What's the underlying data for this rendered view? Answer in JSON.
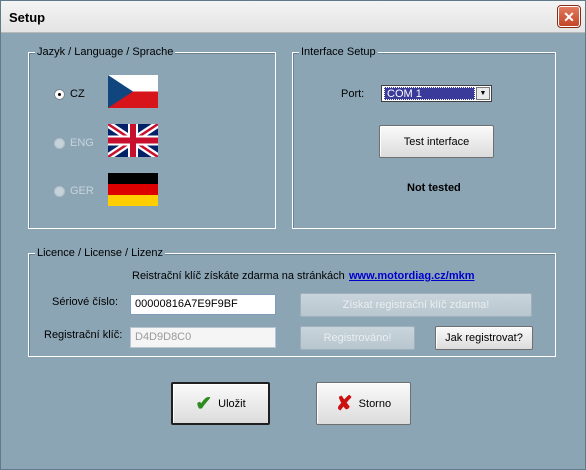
{
  "window": {
    "title": "Setup",
    "close_symbol": "✕"
  },
  "language_group": {
    "label": "Jazyk / Language / Sprache",
    "options": [
      {
        "label": "CZ",
        "selected": true,
        "enabled": true,
        "flag": "czech-flag"
      },
      {
        "label": "ENG",
        "selected": false,
        "enabled": false,
        "flag": "uk-flag"
      },
      {
        "label": "GER",
        "selected": false,
        "enabled": false,
        "flag": "german-flag"
      }
    ]
  },
  "interface_group": {
    "label": "Interface Setup",
    "port_label": "Port:",
    "port_value": "COM 1",
    "test_button": "Test interface",
    "status": "Not tested"
  },
  "licence_group": {
    "label": "Licence / License / Lizenz",
    "info_text": "Reistrační klíč získáte zdarma na stránkách",
    "info_link": "www.motordiag.cz/mkm",
    "serial_label": "Sériové číslo:",
    "serial_value": "00000816A7E9F9BF",
    "reg_key_label": "Registrační klíč:",
    "reg_key_value": "D4D9D8C0",
    "get_key_button": "Získat registrační klíč zdarma!",
    "registered_button": "Registrováno!",
    "how_to_button": "Jak registrovat?"
  },
  "footer": {
    "save_button": "Uložit",
    "cancel_button": "Storno",
    "save_icon": "checkmark-icon",
    "cancel_icon": "x-icon"
  }
}
